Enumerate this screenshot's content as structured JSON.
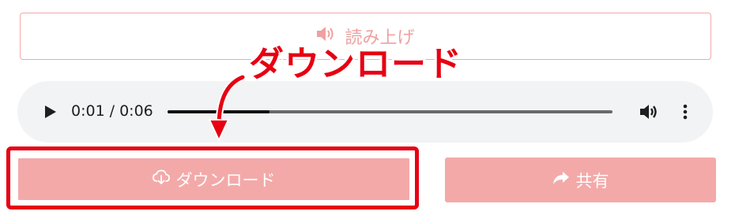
{
  "read_aloud": {
    "label": "読み上げ",
    "icon": "speaker-icon"
  },
  "annotation": {
    "text": "ダウンロード",
    "color": "#e60012"
  },
  "audio_player": {
    "current_time": "0:01",
    "separator": "/",
    "duration": "0:06",
    "progress": 0.23,
    "icons": [
      "play-icon",
      "volume-icon",
      "more-vertical-icon"
    ]
  },
  "buttons": {
    "download_label": "ダウンロード",
    "download_icon": "cloud-download-icon",
    "share_label": "共有",
    "share_icon": "share-arrow-icon"
  },
  "colors": {
    "accent_light": "#f4a9a9",
    "border_pink": "#f2a8a8",
    "highlight_red": "#e60012",
    "player_bg": "#f1f3f4"
  }
}
